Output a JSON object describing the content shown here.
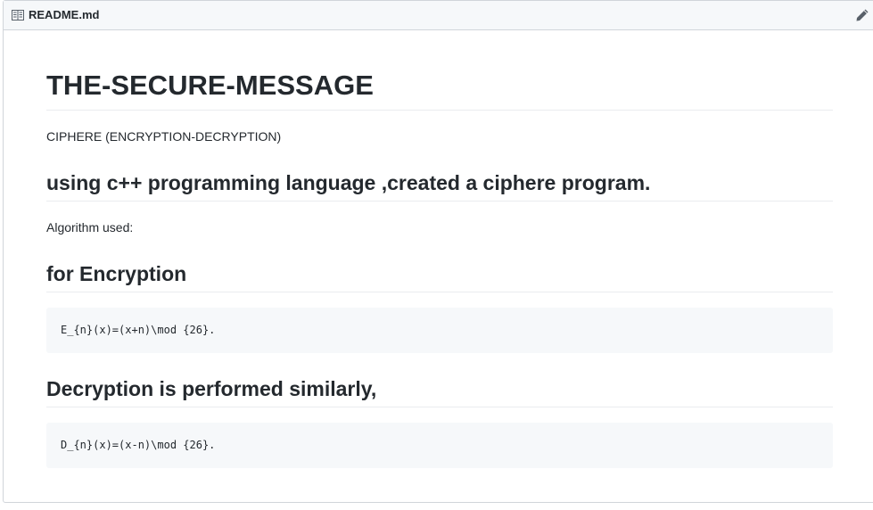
{
  "header": {
    "file_name": "README.md",
    "file_icon": "book-icon",
    "edit_icon": "pencil-icon"
  },
  "content": {
    "title": "THE-SECURE-MESSAGE",
    "subtitle": "CIPHERE (ENCRYPTION-DECRYPTION)",
    "heading_1": "using c++ programming language ,created a ciphere program.",
    "algorithm_label": "Algorithm used:",
    "heading_2": "for Encryption",
    "code_encrypt": "E_{n}(x)=(x+n)\\mod {26}.",
    "heading_3": "Decryption is performed similarly,",
    "code_decrypt": "D_{n}(x)=(x-n)\\mod {26}."
  },
  "colors": {
    "text": "#24292e",
    "header_bg": "#f6f8fa",
    "border": "#d1d5da",
    "code_bg": "#f6f8fa",
    "rule": "#eaecef"
  }
}
